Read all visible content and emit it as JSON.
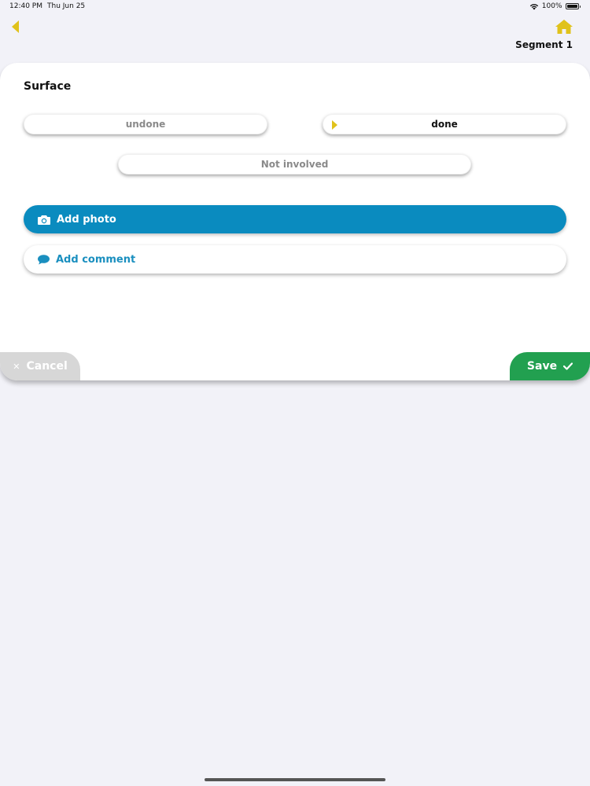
{
  "status": {
    "time": "12:40 PM",
    "date": "Thu Jun 25",
    "battery": "100%"
  },
  "header": {
    "segment": "Segment 1"
  },
  "card": {
    "title": "Surface",
    "options": {
      "undone": "undone",
      "done": "done",
      "not_involved": "Not involved"
    },
    "add_photo": "Add photo",
    "add_comment": "Add comment"
  },
  "footer": {
    "cancel": "Cancel",
    "save": "Save"
  },
  "colors": {
    "accent_yellow": "#e0c21b",
    "photo_blue": "#0a8bbf",
    "save_green": "#22a050"
  }
}
